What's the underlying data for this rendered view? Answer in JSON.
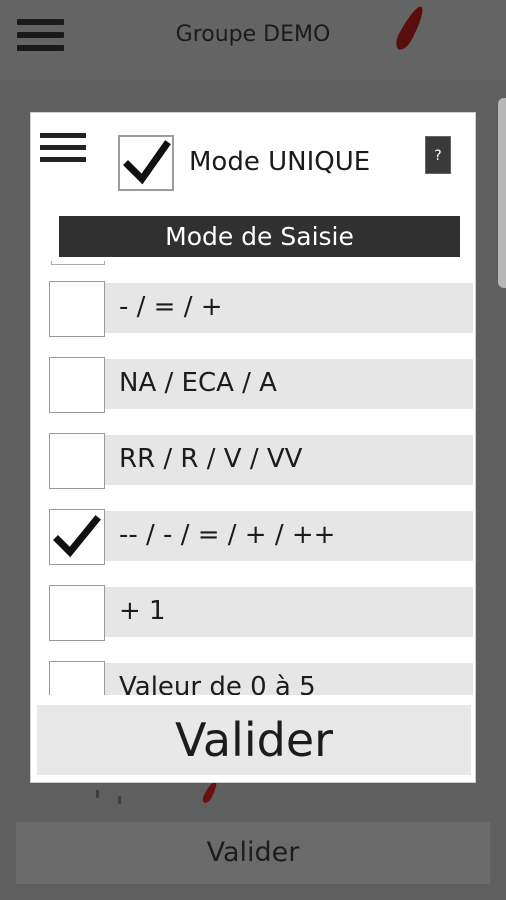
{
  "background": {
    "title": "Groupe DEMO",
    "validate_label": "Valider"
  },
  "dialog": {
    "mode_label": "Mode UNIQUE",
    "mode_checked": true,
    "help_label": "?",
    "section_title": "Mode de Saisie",
    "items": [
      {
        "label": "- / = / +",
        "checked": false
      },
      {
        "label": "NA / ECA / A",
        "checked": false
      },
      {
        "label": "RR / R / V / VV",
        "checked": false
      },
      {
        "label": "-- / - / = / + / ++",
        "checked": true
      },
      {
        "label": "+ 1",
        "checked": false
      },
      {
        "label": "Valeur de 0 à 5",
        "checked": false
      }
    ],
    "validate_label": "Valider"
  },
  "colors": {
    "overlay": "#5f5f5f",
    "section_bar": "#303030",
    "row_background": "#e6e6e6",
    "accent_leaf": "#5a0d0d"
  }
}
